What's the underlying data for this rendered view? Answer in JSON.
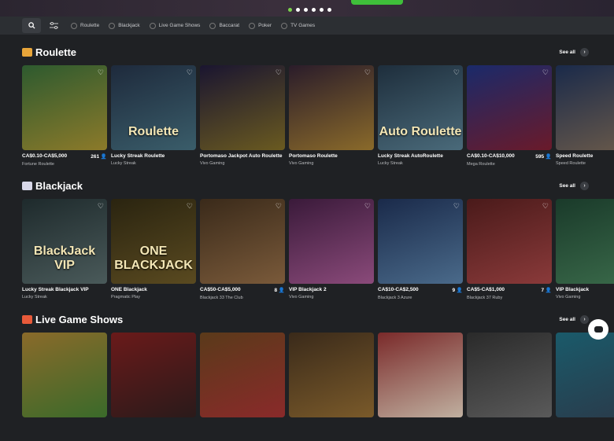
{
  "categories": [
    "Roulette",
    "Blackjack",
    "Live Game Shows",
    "Baccarat",
    "Poker",
    "TV Games"
  ],
  "sections": [
    {
      "title": "Roulette",
      "see_all": "See all",
      "cards": [
        {
          "top": "CA$0.10-CA$5,000",
          "count": "261",
          "name": "Fortune Roulette",
          "overlay": "",
          "bg": "linear-gradient(160deg,#2d5a2f,#8c7a2a)"
        },
        {
          "top": "Lucky Streak Roulette",
          "count": "",
          "name": "Lucky Streak",
          "overlay": "Roulette",
          "bg": "linear-gradient(160deg,#1e2a3c,#3a5d6a)"
        },
        {
          "top": "Portomaso Jackpot Auto Roulette",
          "count": "",
          "name": "Vivo Gaming",
          "overlay": "",
          "bg": "linear-gradient(160deg,#1a1530,#6a5a20)"
        },
        {
          "top": "Portomaso Roulette",
          "count": "",
          "name": "Vivo Gaming",
          "overlay": "",
          "bg": "linear-gradient(160deg,#2a1c2a,#8a6a2a)"
        },
        {
          "top": "Lucky Streak AutoRoulette",
          "count": "",
          "name": "Lucky Streak",
          "overlay": "Auto Roulette",
          "bg": "linear-gradient(160deg,#1e2e3c,#4a6a7a)"
        },
        {
          "top": "CA$0.10-CA$10,000",
          "count": "595",
          "name": "Mega Roulette",
          "overlay": "",
          "bg": "linear-gradient(160deg,#1a2a6a,#6a1a2a)"
        },
        {
          "top": "Speed Roulette",
          "count": "",
          "name": "Speed Roulette",
          "overlay": "",
          "bg": "linear-gradient(160deg,#1a2a4a,#6a5a4a)"
        }
      ]
    },
    {
      "title": "Blackjack",
      "see_all": "See all",
      "cards": [
        {
          "top": "Lucky Streak Blackjack VIP",
          "count": "",
          "name": "Lucky Streak",
          "overlay": "BlackJack VIP",
          "bg": "linear-gradient(160deg,#1e2a2c,#4a5a5a)"
        },
        {
          "top": "ONE Blackjack",
          "count": "",
          "name": "Pragmatic Play",
          "overlay": "ONE BLACKJACK",
          "bg": "linear-gradient(160deg,#2a2410,#5a4a20)"
        },
        {
          "top": "CA$50-CA$5,000",
          "count": "8",
          "name": "Blackjack 33 The Club",
          "overlay": "",
          "bg": "linear-gradient(160deg,#3a2a1a,#7a5a3a)"
        },
        {
          "top": "VIP Blackjack 2",
          "count": "",
          "name": "Vivo Gaming",
          "overlay": "",
          "bg": "linear-gradient(160deg,#3a1a3a,#8a4a7a)"
        },
        {
          "top": "CA$10-CA$2,500",
          "count": "9",
          "name": "Blackjack 3 Azure",
          "overlay": "",
          "bg": "linear-gradient(160deg,#1a2a4a,#4a6a8a)"
        },
        {
          "top": "CA$5-CA$1,000",
          "count": "7",
          "name": "Blackjack 37 Ruby",
          "overlay": "",
          "bg": "linear-gradient(160deg,#4a1a1a,#8a3a3a)"
        },
        {
          "top": "VIP Blackjack",
          "count": "",
          "name": "Vivo Gaming",
          "overlay": "",
          "bg": "linear-gradient(160deg,#1a3a2a,#3a6a4a)"
        }
      ]
    },
    {
      "title": "Live Game Shows",
      "see_all": "See all"
    }
  ],
  "colors": {
    "accent": "#3fbf3a",
    "bg": "#1f2124"
  }
}
